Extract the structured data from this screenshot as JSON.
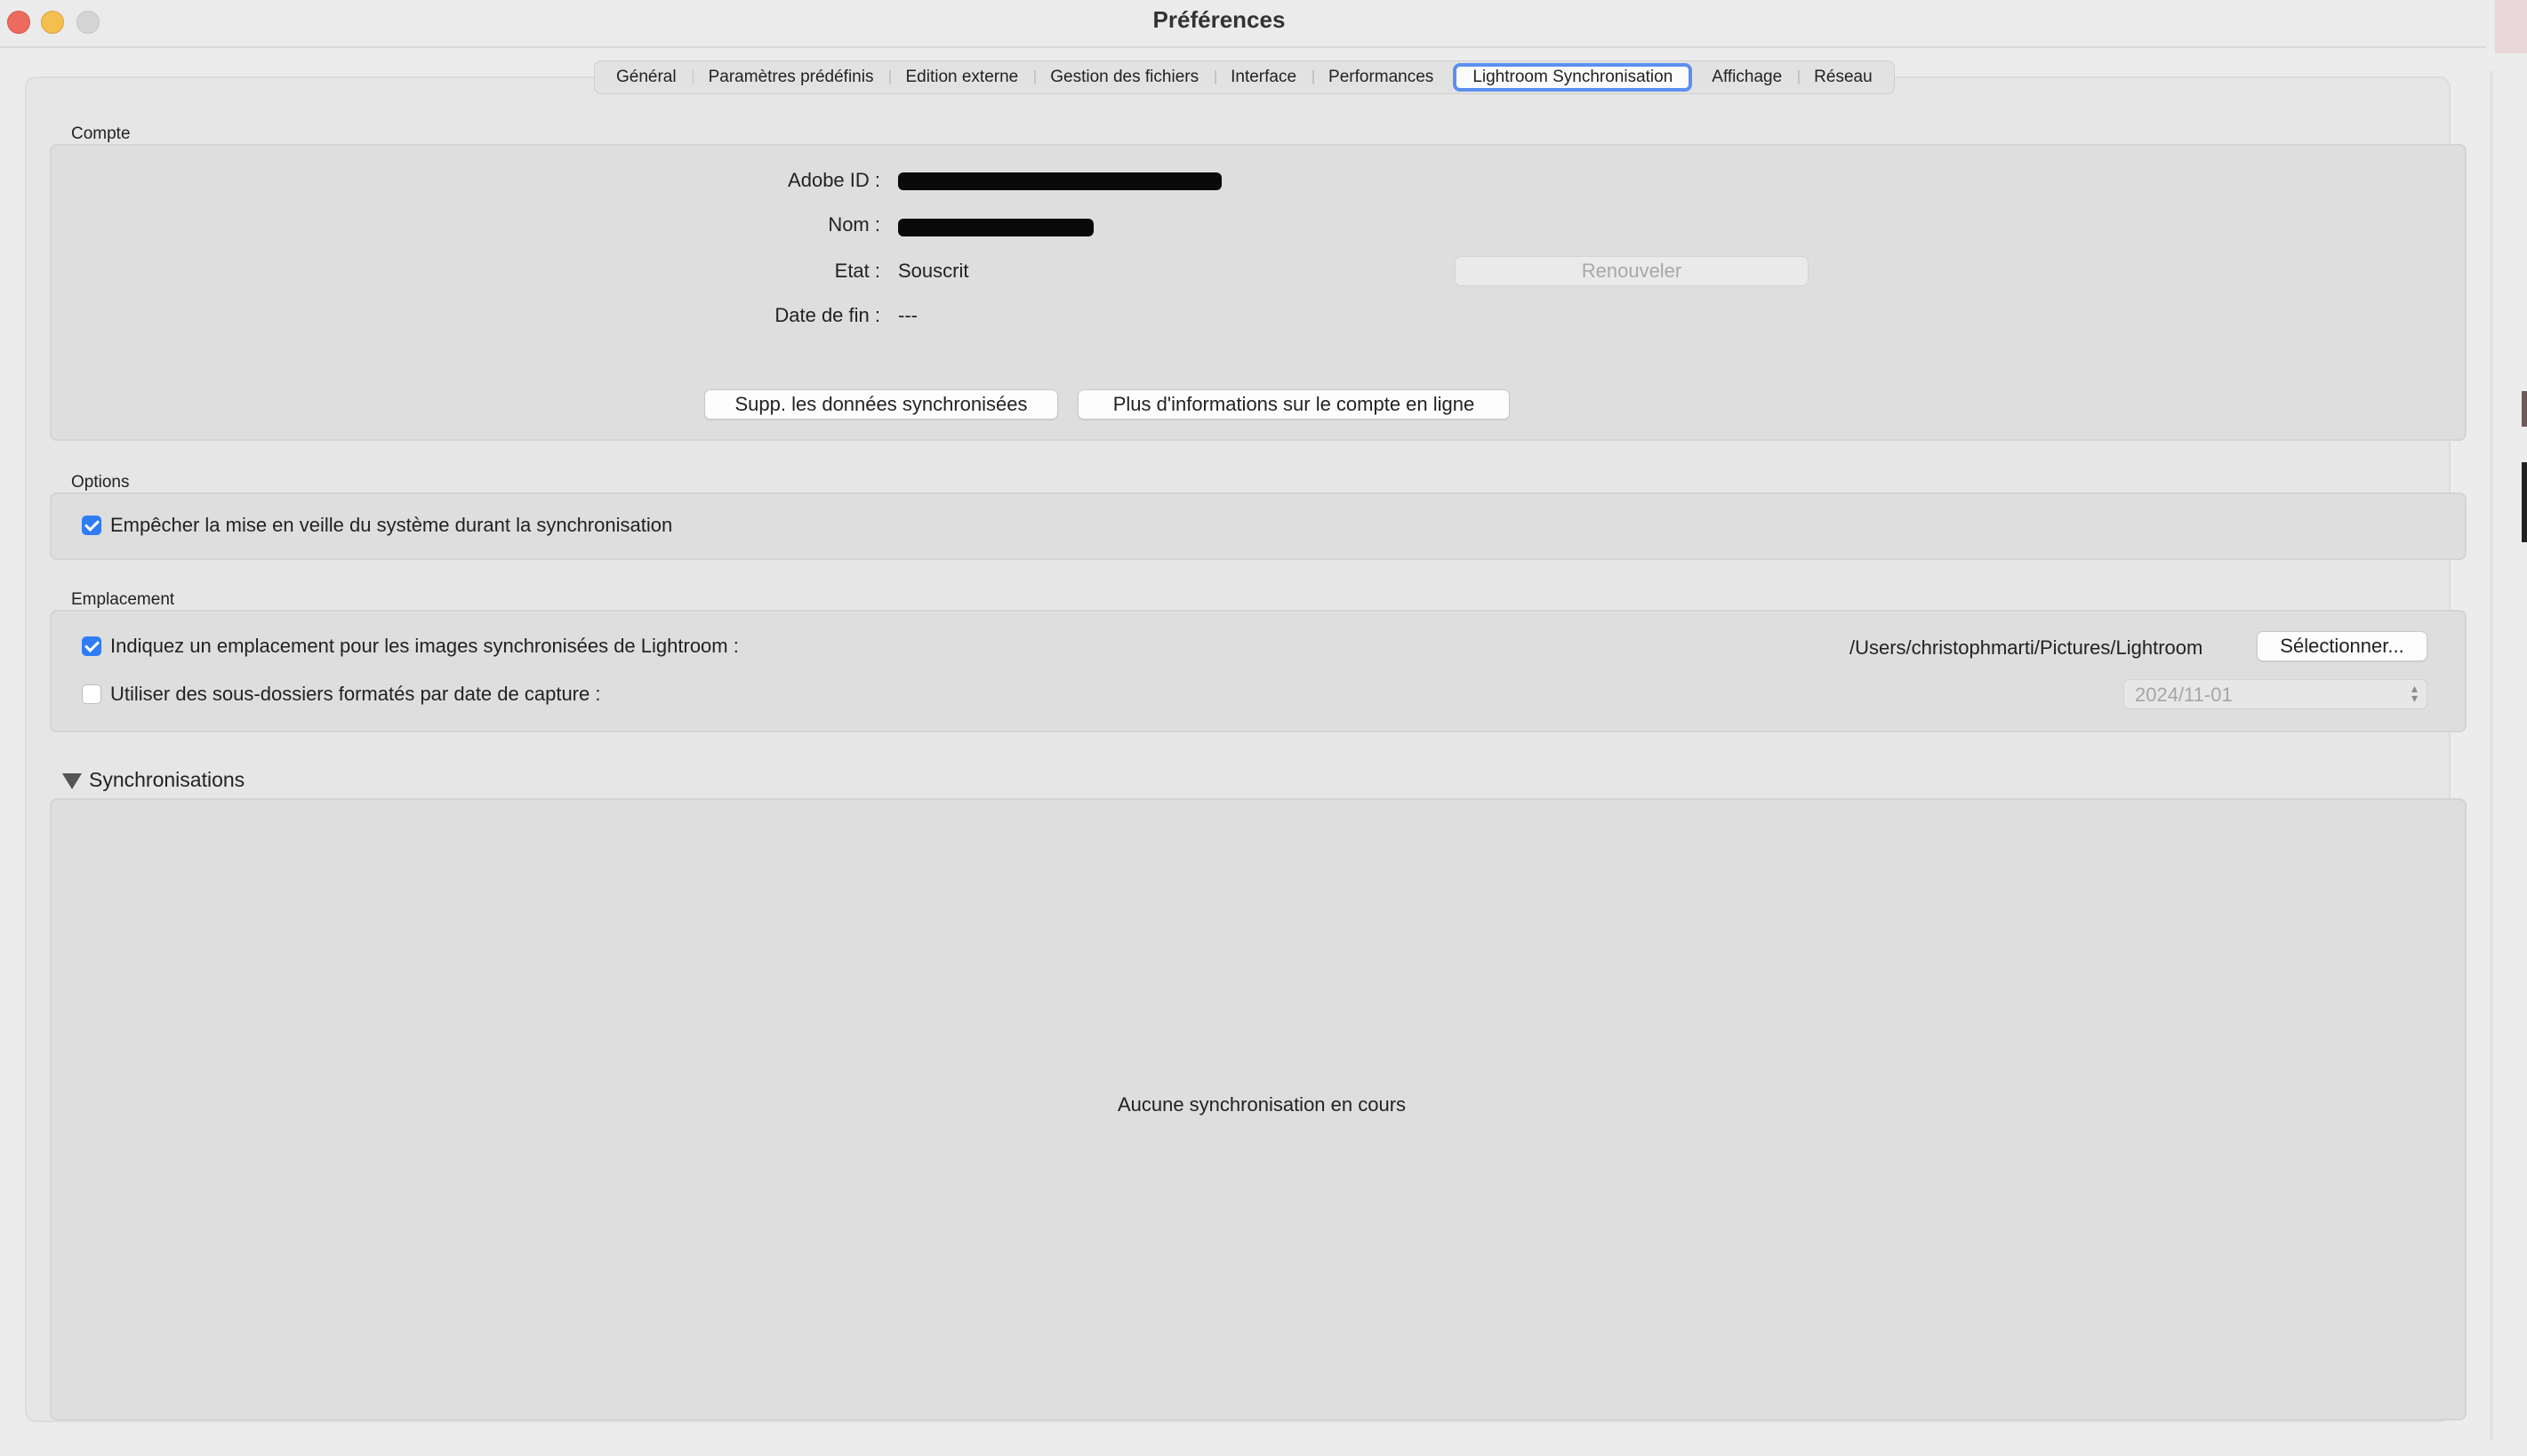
{
  "window": {
    "title": "Préférences"
  },
  "tabs": [
    {
      "label": "Général"
    },
    {
      "label": "Paramètres prédéfinis"
    },
    {
      "label": "Edition externe"
    },
    {
      "label": "Gestion des fichiers"
    },
    {
      "label": "Interface"
    },
    {
      "label": "Performances"
    },
    {
      "label": "Lightroom Synchronisation",
      "active": true
    },
    {
      "label": "Affichage"
    },
    {
      "label": "Réseau"
    }
  ],
  "account": {
    "section_label": "Compte",
    "adobe_id_label": "Adobe ID :",
    "name_label": "Nom :",
    "state_label": "Etat :",
    "state_value": "Souscrit",
    "end_date_label": "Date de fin :",
    "end_date_value": "---",
    "renew_button": "Renouveler",
    "delete_synced_button": "Supp. les données synchronisées",
    "more_info_button": "Plus d'informations sur le compte en ligne"
  },
  "options": {
    "section_label": "Options",
    "prevent_sleep_label": "Empêcher la mise en veille du système durant la synchronisation",
    "prevent_sleep_checked": true
  },
  "location": {
    "section_label": "Emplacement",
    "specify_location_label": "Indiquez un emplacement pour les images synchronisées de Lightroom :",
    "specify_location_checked": true,
    "path": "/Users/christophmarti/Pictures/Lightroom",
    "select_button": "Sélectionner...",
    "subfolders_label": "Utiliser des sous-dossiers formatés par date de capture :",
    "subfolders_checked": false,
    "date_format_value": "2024/11-01"
  },
  "syncs": {
    "section_label": "Synchronisations",
    "empty_message": "Aucune synchronisation en cours"
  },
  "colors": {
    "accent": "#2f7cf6",
    "close": "#ed6a5e",
    "minimize": "#f5bf4f",
    "zoom": "#d5d5d5"
  }
}
